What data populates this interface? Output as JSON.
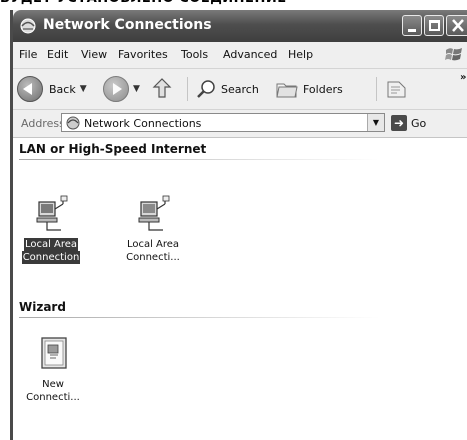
{
  "caption": "БУДЕТ УСТАНОВЛЕНО СОЕДИНЕНИЕ",
  "window": {
    "title": "Network Connections"
  },
  "menu": {
    "items": [
      "File",
      "Edit",
      "View",
      "Favorites",
      "Tools",
      "Advanced",
      "Help"
    ]
  },
  "toolbar": {
    "back_label": "Back",
    "search_label": "Search",
    "folders_label": "Folders"
  },
  "address": {
    "label": "Address",
    "value": "Network Connections",
    "go_label": "Go"
  },
  "groups": [
    {
      "header": "LAN or High-Speed Internet",
      "items": [
        {
          "line1": "Local Area",
          "line2": "Connection",
          "selected": true
        },
        {
          "line1": "Local Area",
          "line2": "Connecti...",
          "selected": false
        }
      ]
    },
    {
      "header": "Wizard",
      "items": [
        {
          "line1": "New",
          "line2": "Connecti...",
          "selected": false
        }
      ]
    }
  ]
}
